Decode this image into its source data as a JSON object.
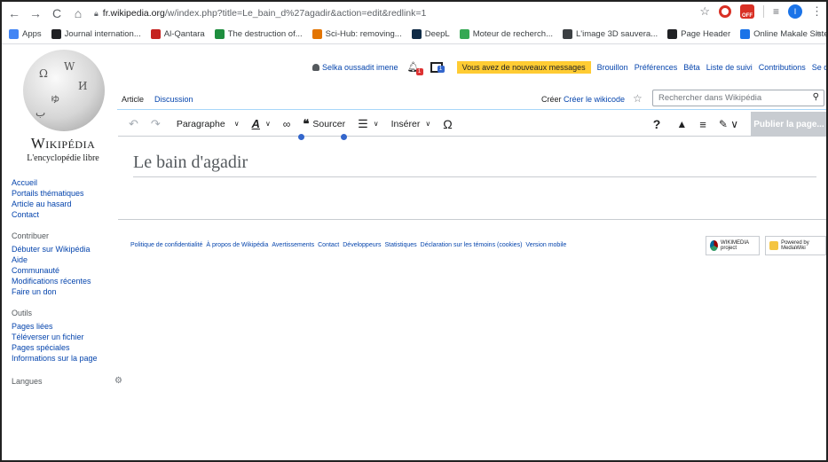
{
  "browser": {
    "url_host": "fr.wikipedia.org",
    "url_path": "/w/index.php?title=Le_bain_d%27agadir&action=edit&redlink=1",
    "profile_initial": "I",
    "ext_off_label": "OFF"
  },
  "bookmarks": [
    {
      "label": "Apps",
      "icon": "apps-grid-icon",
      "color": "#4285f4"
    },
    {
      "label": "Journal internation...",
      "icon": "journal-icon",
      "color": "#202124"
    },
    {
      "label": "Al-Qantara",
      "icon": "r-logo-icon",
      "color": "#c5221f"
    },
    {
      "label": "The destruction of...",
      "icon": "c-logo-icon",
      "color": "#1e8e3e"
    },
    {
      "label": "Sci-Hub: removing...",
      "icon": "scihub-icon",
      "color": "#e37400"
    },
    {
      "label": "DeepL",
      "icon": "deepl-icon",
      "color": "#0f2b46"
    },
    {
      "label": "Moteur de recherch...",
      "icon": "globe-green-icon",
      "color": "#34a853"
    },
    {
      "label": "L'image 3D sauvera...",
      "icon": "flag-icon",
      "color": "#3c4043"
    },
    {
      "label": "Page Header",
      "icon": "github-icon",
      "color": "#202124"
    },
    {
      "label": "Online Makale Siste...",
      "icon": "dergipark-icon",
      "color": "#1a73e8"
    }
  ],
  "logo": {
    "wordmark": "Wikipédia",
    "tagline": "L'encyclopédie libre"
  },
  "sidebar": {
    "nav": [
      "Accueil",
      "Portails thématiques",
      "Article au hasard",
      "Contact"
    ],
    "contribute_heading": "Contribuer",
    "contribute": [
      "Débuter sur Wikipédia",
      "Aide",
      "Communauté",
      "Modifications récentes",
      "Faire un don"
    ],
    "tools_heading": "Outils",
    "tools": [
      "Pages liées",
      "Téléverser un fichier",
      "Pages spéciales",
      "Informations sur la page"
    ],
    "languages_heading": "Langues"
  },
  "personal": {
    "username": "Selka oussadit imene",
    "alerts_count": "1",
    "notices_count": "1",
    "new_messages": "Vous avez de nouveaux messages",
    "links": [
      "Brouillon",
      "Préférences",
      "Bêta",
      "Liste de suivi",
      "Contributions",
      "Se déconnecter"
    ]
  },
  "tabs": {
    "article": "Article",
    "discussion": "Discussion",
    "create": "Créer",
    "create_wikicode": "Créer le wikicode"
  },
  "search": {
    "placeholder": "Rechercher dans Wikipédia"
  },
  "toolbar": {
    "paragraph": "Paragraphe",
    "cite": "Sourcer",
    "insert": "Insérer",
    "publish": "Publier la page..."
  },
  "editor": {
    "title": "Le bain d'agadir"
  },
  "footer": {
    "links": [
      "Politique de confidentialité",
      "À propos de Wikipédia",
      "Avertissements",
      "Contact",
      "Développeurs",
      "Statistiques",
      "Déclaration sur les témoins (cookies)",
      "Version mobile"
    ],
    "badge_wikimedia": "WIKIMEDIA project",
    "badge_mediawiki": "Powered by MediaWiki"
  }
}
